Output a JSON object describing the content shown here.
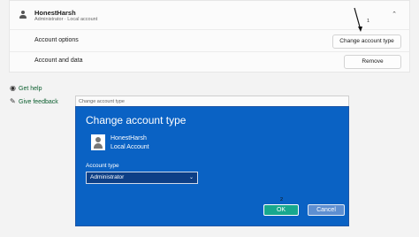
{
  "account": {
    "name": "HonestHarsh",
    "subtitle": "Administrator  ·  Local account"
  },
  "rows": {
    "options_label": "Account options",
    "options_button": "Change account type",
    "data_label": "Account and data",
    "data_button": "Remove"
  },
  "annotations": {
    "step1": "1",
    "step2": "2"
  },
  "links": {
    "help": "Get help",
    "feedback": "Give feedback"
  },
  "dialog": {
    "titlebar": "Change account type",
    "heading": "Change account type",
    "user_name": "HonestHarsh",
    "user_type": "Local Account",
    "type_label": "Account type",
    "selected_type": "Administrator",
    "ok": "OK",
    "cancel": "Cancel"
  },
  "colors": {
    "dialog_bg": "#0a62c4",
    "ok_button": "#18a88e",
    "link": "#0b5e2e"
  },
  "icons": [
    "person-icon",
    "chevron-up-icon",
    "help-icon",
    "feedback-icon",
    "dropdown-chevron-icon"
  ]
}
